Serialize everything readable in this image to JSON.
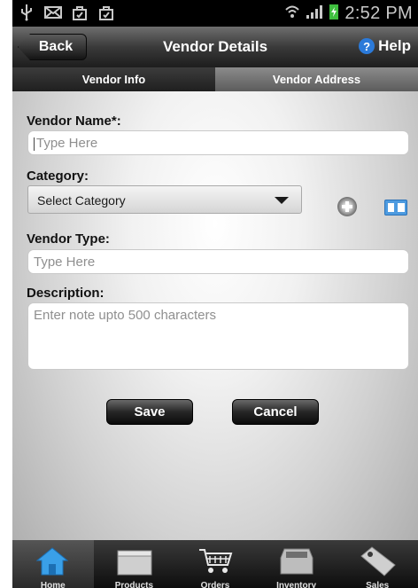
{
  "status_bar": {
    "time": "2:52 PM"
  },
  "header": {
    "back_label": "Back",
    "title": "Vendor Details",
    "help_label": "Help",
    "help_icon_glyph": "?"
  },
  "tabs": [
    {
      "label": "Vendor Info",
      "active": true
    },
    {
      "label": "Vendor Address",
      "active": false
    }
  ],
  "form": {
    "vendor_name": {
      "label": "Vendor Name*:",
      "placeholder": "Type Here",
      "value": ""
    },
    "category": {
      "label": "Category:",
      "selected": "Select Category"
    },
    "vendor_type": {
      "label": "Vendor Type:",
      "placeholder": "Type Here",
      "value": ""
    },
    "description": {
      "label": "Description:",
      "placeholder": "Enter note upto 500 characters",
      "value": ""
    }
  },
  "buttons": {
    "save": "Save",
    "cancel": "Cancel"
  },
  "bottom_nav": [
    {
      "label": "Home",
      "icon": "home-icon",
      "active": true
    },
    {
      "label": "Products",
      "icon": "products-box-icon",
      "active": false
    },
    {
      "label": "Orders",
      "icon": "cart-icon",
      "active": false
    },
    {
      "label": "Inventory",
      "icon": "inventory-box-icon",
      "active": false
    },
    {
      "label": "Sales",
      "icon": "price-tag-icon",
      "active": false
    }
  ],
  "colors": {
    "accent_blue": "#2b7ad9",
    "home_icon_blue": "#3aa0e8",
    "titlebar_dark": "#1d1d1d"
  }
}
